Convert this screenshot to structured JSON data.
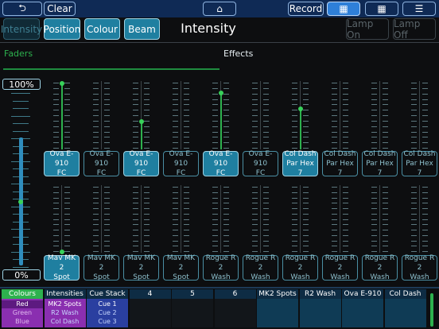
{
  "topbar": {
    "back_label": "⮌",
    "clear_label": "Clear",
    "home_label": "⌂",
    "record_label": "Record",
    "view1_label": "▦",
    "view2_label": "▦",
    "menu_label": "☰"
  },
  "header": {
    "tabs": [
      {
        "label": "Intensity",
        "state": "inactive"
      },
      {
        "label": "Position",
        "state": "active"
      },
      {
        "label": "Colour",
        "state": "active"
      },
      {
        "label": "Beam",
        "state": "active"
      }
    ],
    "title": "Intensity",
    "lamp_on_label": "Lamp On",
    "lamp_off_label": "Lamp Off"
  },
  "subtabs": {
    "faders_label": "Faders",
    "effects_label": "Effects"
  },
  "master": {
    "top_label": "100%",
    "bottom_label": "0%",
    "level_percent": 100
  },
  "top_faders": [
    {
      "label1": "Ova E-910",
      "label2": "FC",
      "selected": true,
      "level_percent": 100
    },
    {
      "label1": "Ova E-910",
      "label2": "FC",
      "selected": false,
      "level_percent": 0
    },
    {
      "label1": "Ova E-910",
      "label2": "FC",
      "selected": true,
      "level_percent": 40
    },
    {
      "label1": "Ova E-910",
      "label2": "FC",
      "selected": false,
      "level_percent": 0
    },
    {
      "label1": "Ova E-910",
      "label2": "FC",
      "selected": true,
      "level_percent": 85
    },
    {
      "label1": "Ova E-910",
      "label2": "FC",
      "selected": false,
      "level_percent": 0
    },
    {
      "label1": "Col Dash",
      "label2": "Par Hex 7",
      "selected": true,
      "level_percent": 60
    },
    {
      "label1": "Col Dash",
      "label2": "Par Hex 7",
      "selected": false,
      "level_percent": 0
    },
    {
      "label1": "Col Dash",
      "label2": "Par Hex 7",
      "selected": false,
      "level_percent": 0
    },
    {
      "label1": "Col Dash",
      "label2": "Par Hex 7",
      "selected": false,
      "level_percent": 0
    }
  ],
  "bottom_faders": [
    {
      "label1": "Mav MK 2",
      "label2": "Spot",
      "selected": true,
      "level_percent": 0
    },
    {
      "label1": "Mav MK 2",
      "label2": "Spot",
      "selected": false,
      "level_percent": 0
    },
    {
      "label1": "Mav MK 2",
      "label2": "Spot",
      "selected": false,
      "level_percent": 0
    },
    {
      "label1": "Mav MK 2",
      "label2": "Spot",
      "selected": false,
      "level_percent": 0
    },
    {
      "label1": "Rogue R 2",
      "label2": "Wash",
      "selected": false,
      "level_percent": 0
    },
    {
      "label1": "Rogue R 2",
      "label2": "Wash",
      "selected": false,
      "level_percent": 0
    },
    {
      "label1": "Rogue R 2",
      "label2": "Wash",
      "selected": false,
      "level_percent": 0
    },
    {
      "label1": "Rogue R 2",
      "label2": "Wash",
      "selected": false,
      "level_percent": 0
    },
    {
      "label1": "Rogue R 2",
      "label2": "Wash",
      "selected": false,
      "level_percent": 0
    },
    {
      "label1": "Rogue R 2",
      "label2": "Wash",
      "selected": false,
      "level_percent": 0
    }
  ],
  "playbacks": [
    {
      "title": "Colours",
      "items": [
        "Red",
        "Green",
        "Blue"
      ],
      "color": "#8a2fb0",
      "title_color": "#2db14e"
    },
    {
      "title": "Intensities",
      "items": [
        "MK2 Spots",
        "R2 Wash",
        "Col Dash"
      ],
      "color": "#8a2fb0",
      "title_color": "#0e2c44"
    },
    {
      "title": "Cue Stack",
      "items": [
        "Cue 1",
        "Cue 2",
        "Cue 3"
      ],
      "color": "#2a3fa0",
      "title_color": "#0e2c44"
    },
    {
      "title": "4",
      "items": [],
      "color": "#12161a",
      "title_color": "#0e2c44"
    },
    {
      "title": "5",
      "items": [],
      "color": "#12161a",
      "title_color": "#0e2c44"
    },
    {
      "title": "6",
      "items": [],
      "color": "#12161a",
      "title_color": "#0e2c44"
    },
    {
      "title": "MK2 Spots",
      "items": [],
      "color": "#0f3b55",
      "title_color": "#0e2c44"
    },
    {
      "title": "R2 Wash",
      "items": [],
      "color": "#0f3b55",
      "title_color": "#0e2c44"
    },
    {
      "title": "Ova E-910",
      "items": [],
      "color": "#0f3b55",
      "title_color": "#0e2c44"
    },
    {
      "title": "Col Dash",
      "items": [],
      "color": "#0f3b55",
      "title_color": "#0e2c44"
    }
  ]
}
